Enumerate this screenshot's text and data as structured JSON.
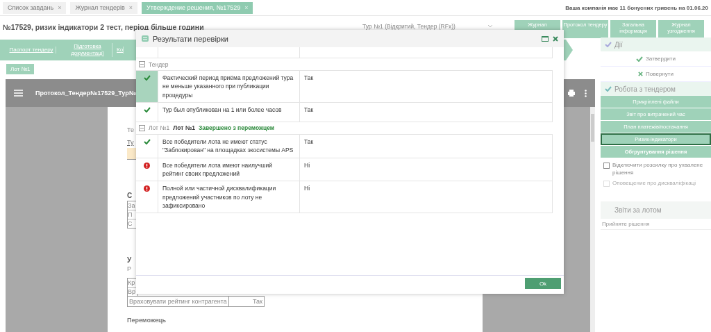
{
  "tabs": [
    {
      "label": "Список завдань",
      "close": "×",
      "selected": false
    },
    {
      "label": "Журнал тендерів",
      "close": "×",
      "selected": false
    },
    {
      "label": "Утверждение решения, №17529",
      "close": "×",
      "selected": true
    }
  ],
  "bonus_notice": "Ваша компанія має 11 бонусних гривень на 01.06.20",
  "title": "№17529, ризик індикатори 2 тест, період більше години",
  "round_select": {
    "value": "Тур №1 (Відкритий, Тендер (RFx))"
  },
  "header_buttons": [
    "Журнал",
    "Протокол тендеру",
    "Загальна інформація",
    "Журнал узгодження"
  ],
  "steps": [
    "Паспорт тендеру",
    "Підготовка документації",
    "Ко"
  ],
  "lot_button": "Лот №1",
  "document": {
    "title": "Протокол_Тендер№17529_Тур№",
    "fragments": [
      {
        "kind": "text",
        "text": "Те"
      },
      {
        "kind": "link",
        "text": "Ту"
      },
      {
        "kind": "field"
      },
      {
        "kind": "heading",
        "text": "С"
      },
      {
        "kind": "table",
        "cells": [
          "За",
          "П",
          "С"
        ]
      },
      {
        "kind": "heading",
        "text": "У"
      },
      {
        "kind": "text",
        "text": "Р"
      },
      {
        "kind": "table",
        "cells": [
          "Кр",
          "Вр"
        ]
      }
    ],
    "rating_row": {
      "label": "Враховувати рейтинг контрагента",
      "value": "Так"
    },
    "footer": "Переможець"
  },
  "dialog": {
    "title": "Результати перевірки",
    "groups": [
      {
        "label": "Тендер",
        "expanded": true,
        "rows": [
          {
            "kind": "ok",
            "text": "Фактический период приёма предложений тура не меньше указанного при публикации процедуры",
            "value": "Так",
            "selected": true
          },
          {
            "kind": "ok",
            "text": "Тур был опубликован на 1 или более часов",
            "value": "Так",
            "selected": false
          }
        ]
      },
      {
        "label": "Лот №1",
        "name": "Лот №1",
        "status_text": "Завершено з переможцем",
        "expanded": true,
        "rows": [
          {
            "kind": "ok",
            "text": "Все победители лота не имеют статус \"Заблокирован\" на площадках экосистемы APS",
            "value": "Так",
            "selected": false
          },
          {
            "kind": "error",
            "text": "Все победители лота имеют наилучший рейтинг своих предложений",
            "value": "Ні",
            "selected": false
          },
          {
            "kind": "error",
            "text": "Полной или частичной дисквалификации предложений участников по лоту не зафиксировано",
            "value": "Ні",
            "selected": false
          }
        ]
      }
    ],
    "ok_button": "Ok"
  },
  "actions": {
    "title": "Дії",
    "items": [
      {
        "kind": "approve",
        "label": "Затвердити"
      },
      {
        "kind": "return",
        "label": "Повернути"
      }
    ]
  },
  "tender_work": {
    "title": "Робота з тендером",
    "buttons": [
      {
        "label": "Прикріплені файли",
        "selected": false,
        "bold": false
      },
      {
        "label": "Звіт про витрачений час",
        "selected": false,
        "bold": false
      },
      {
        "label": "План платежів/постачання",
        "selected": false,
        "bold": false
      },
      {
        "label": "Ризик-індикатори",
        "selected": true,
        "bold": false
      },
      {
        "label": "Обгрунтування рішення",
        "selected": false,
        "bold": true
      }
    ]
  },
  "checkboxes": [
    {
      "label": "Відключити розсилку про ухвалене рішення",
      "checked": false,
      "disabled": false
    },
    {
      "label": "Оповещение про дискваліфікаці",
      "checked": false,
      "disabled": true
    }
  ],
  "lot_reports": {
    "title": "Звіти за лотом",
    "items": [
      "Прийняте рішення"
    ]
  }
}
